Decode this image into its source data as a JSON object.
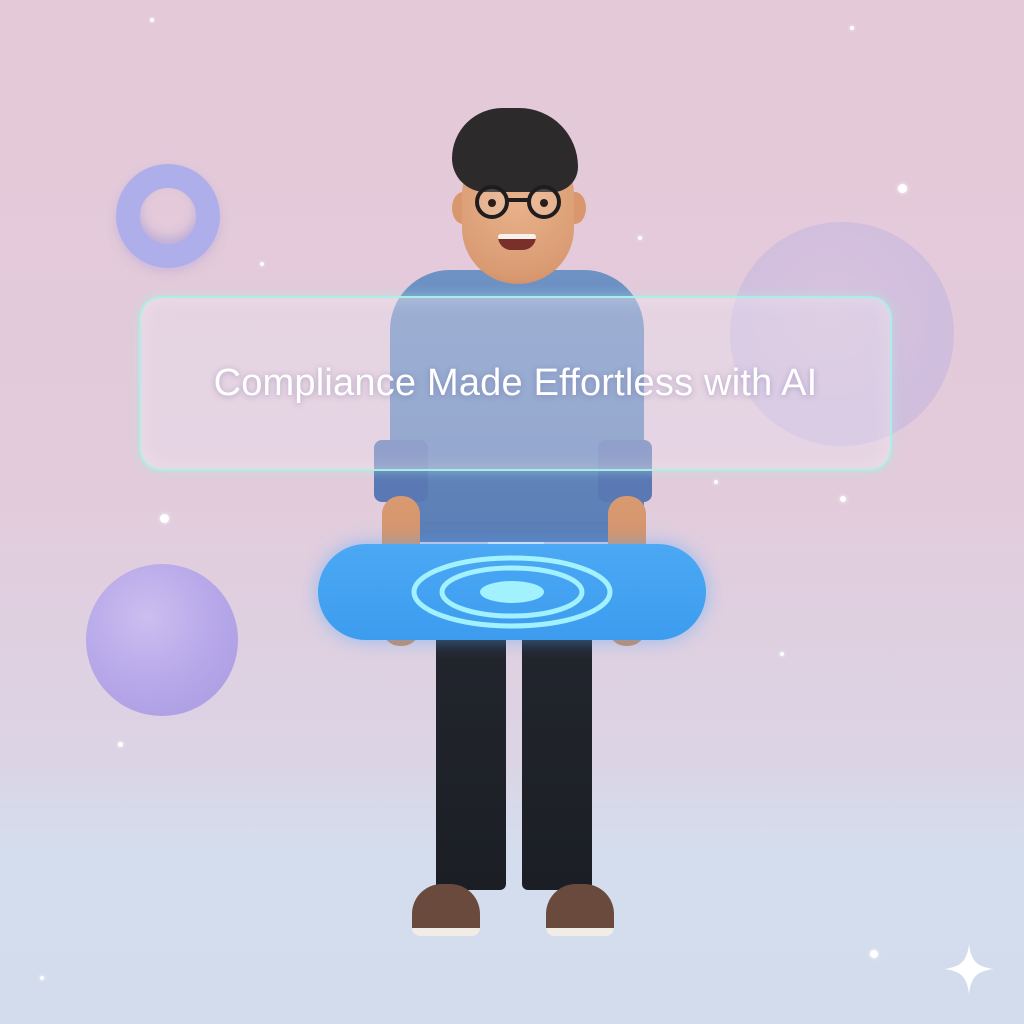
{
  "headline": {
    "text": "Compliance Made Effortless with AI"
  },
  "voice_button": {
    "icon": "sound-wave-rings-icon"
  },
  "decor": {
    "ring": "ring-shape",
    "spheres": [
      "left-purple-sphere",
      "right-translucent-sphere"
    ],
    "corner_icon": "sparkle-star-icon"
  },
  "colors": {
    "background_top": "#e4c9d8",
    "background_bottom": "#d2dcec",
    "panel_border": "#aaf0e8",
    "pill": "#3e9cef",
    "rings": "#a8f6ff",
    "jacket": "#5b7eb6"
  }
}
